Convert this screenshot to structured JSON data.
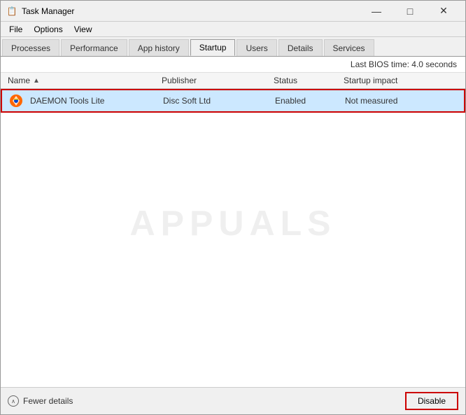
{
  "window": {
    "title": "Task Manager",
    "icon": "📋"
  },
  "title_bar_controls": {
    "minimize": "—",
    "maximize": "□",
    "close": "✕"
  },
  "menu": {
    "items": [
      "File",
      "Options",
      "View"
    ]
  },
  "tabs": [
    {
      "label": "Processes",
      "active": false
    },
    {
      "label": "Performance",
      "active": false
    },
    {
      "label": "App history",
      "active": false
    },
    {
      "label": "Startup",
      "active": true
    },
    {
      "label": "Users",
      "active": false
    },
    {
      "label": "Details",
      "active": false
    },
    {
      "label": "Services",
      "active": false
    }
  ],
  "bios_time": {
    "label": "Last BIOS time:",
    "value": "4.0 seconds"
  },
  "table": {
    "columns": [
      {
        "key": "name",
        "label": "Name",
        "sortable": true
      },
      {
        "key": "publisher",
        "label": "Publisher"
      },
      {
        "key": "status",
        "label": "Status"
      },
      {
        "key": "impact",
        "label": "Startup impact"
      }
    ],
    "rows": [
      {
        "name": "DAEMON Tools Lite",
        "publisher": "Disc Soft Ltd",
        "status": "Enabled",
        "impact": "Not measured",
        "selected": true
      }
    ]
  },
  "footer": {
    "fewer_details_label": "Fewer details",
    "disable_label": "Disable"
  }
}
